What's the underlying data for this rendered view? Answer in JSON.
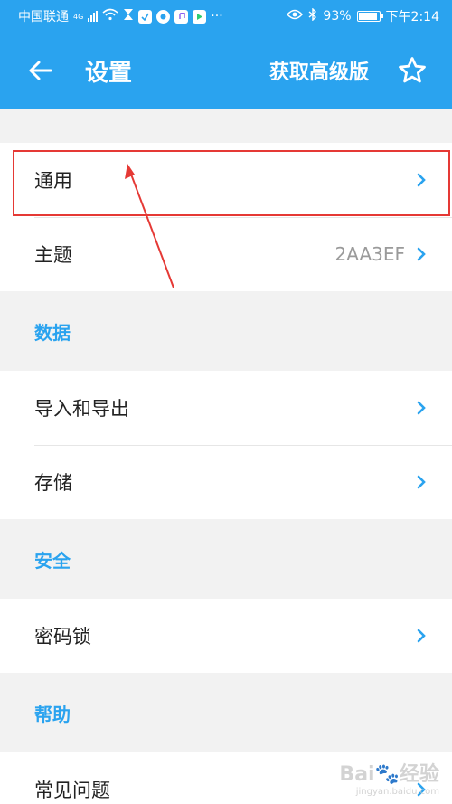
{
  "statusbar": {
    "carrier": "中国联通",
    "network": "4G",
    "battery": "93%",
    "time": "下午2:14",
    "more": "···"
  },
  "appbar": {
    "title": "设置",
    "get_pro": "获取高级版",
    "color": "#2aa3ef"
  },
  "groups": [
    {
      "header": "",
      "rows": [
        {
          "label": "通用",
          "value": ""
        },
        {
          "label": "主题",
          "value": "2AA3EF"
        }
      ]
    },
    {
      "header": "数据",
      "rows": [
        {
          "label": "导入和导出",
          "value": ""
        },
        {
          "label": "存储",
          "value": ""
        }
      ]
    },
    {
      "header": "安全",
      "rows": [
        {
          "label": "密码锁",
          "value": ""
        }
      ]
    },
    {
      "header": "帮助",
      "rows": [
        {
          "label": "常见问题",
          "value": ""
        }
      ]
    }
  ],
  "watermark": {
    "text": "Bai",
    "suffix": "经验",
    "sub": "jingyan.baidu.com"
  },
  "annotation_color": "#e53935"
}
